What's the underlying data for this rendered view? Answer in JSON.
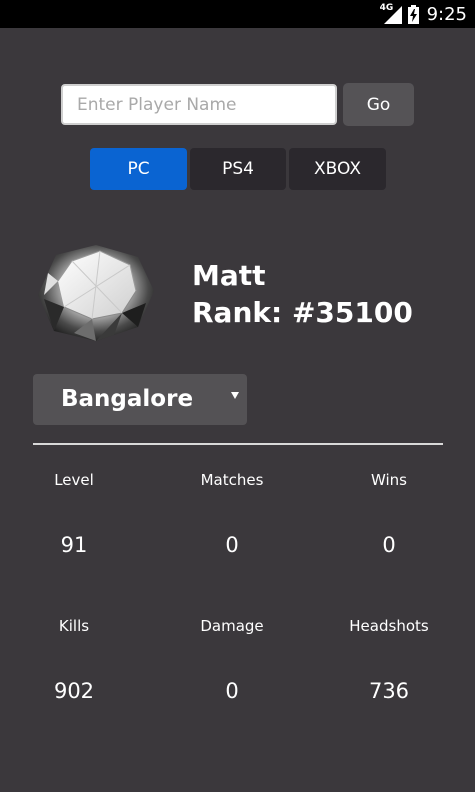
{
  "status_bar": {
    "network_type": "4G",
    "time": "9:25",
    "icons": [
      "signal-icon",
      "battery-charging-icon"
    ]
  },
  "search": {
    "placeholder": "Enter Player Name",
    "value": "",
    "go_label": "Go"
  },
  "platforms": {
    "tabs": [
      {
        "label": "PC",
        "selected": true
      },
      {
        "label": "PS4",
        "selected": false
      },
      {
        "label": "XBOX",
        "selected": false
      }
    ],
    "active_color": "#0a64d2"
  },
  "player": {
    "avatar_icon": "diamond-icon",
    "name": "Matt",
    "rank": "Rank: #35100"
  },
  "region": {
    "selected": "Bangalore"
  },
  "stats": [
    {
      "label": "Level",
      "value": "91"
    },
    {
      "label": "Matches",
      "value": "0"
    },
    {
      "label": "Wins",
      "value": "0"
    },
    {
      "label": "Kills",
      "value": "902"
    },
    {
      "label": "Damage",
      "value": "0"
    },
    {
      "label": "Headshots",
      "value": "736"
    }
  ]
}
